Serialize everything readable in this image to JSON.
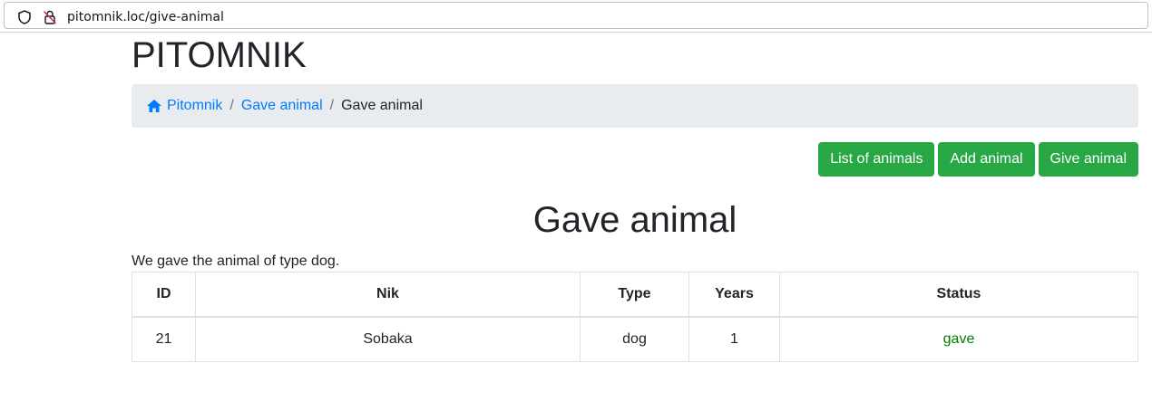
{
  "browser": {
    "url": "pitomnik.loc/give-animal"
  },
  "brand": "PITOMNIK",
  "breadcrumb": {
    "home_label": "Pitomnik",
    "parent_label": "Gave animal",
    "current_label": "Gave animal",
    "separator": "/"
  },
  "actions": {
    "list_label": "List of animals",
    "add_label": "Add animal",
    "give_label": "Give animal"
  },
  "page_title": "Gave animal",
  "message": "We gave the animal of type dog.",
  "table": {
    "headers": [
      "ID",
      "Nik",
      "Type",
      "Years",
      "Status"
    ],
    "rows": [
      [
        "21",
        "Sobaka",
        "dog",
        "1",
        "gave"
      ]
    ]
  },
  "colors": {
    "accent_button": "#28a745",
    "link": "#007bff",
    "status_gave": "#008000"
  }
}
